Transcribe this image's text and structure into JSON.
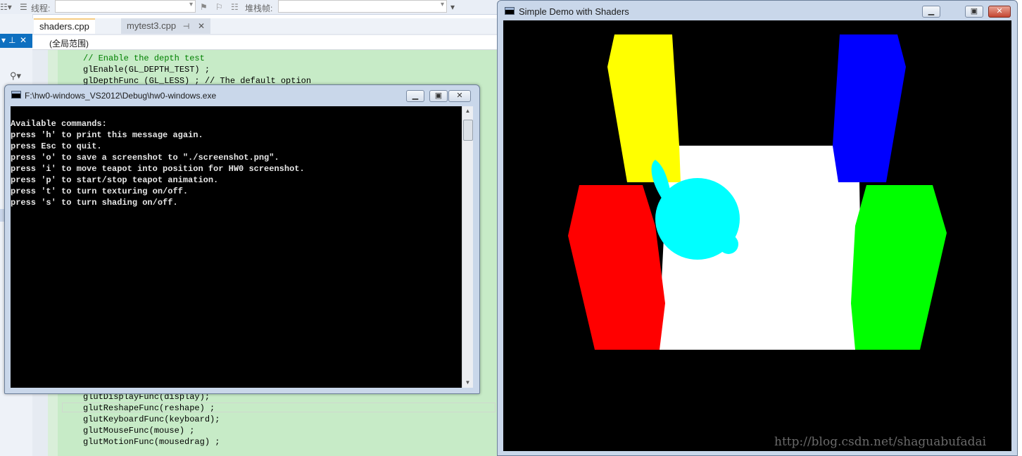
{
  "ide": {
    "toolbar": {
      "thread_label": "线程:",
      "stackframe_label": "堆栈帧:"
    },
    "tabs": [
      {
        "label": "shaders.cpp",
        "active": true
      },
      {
        "label": "mytest3.cpp",
        "active": false
      }
    ],
    "scope": "(全局范围)",
    "code_top": [
      "// Enable the depth test",
      "glEnable(GL_DEPTH_TEST) ;",
      "glDepthFunc (GL_LESS) ; // The default option"
    ],
    "code_bottom": [
      "glutDisplayFunc(display);",
      "glutReshapeFunc(reshape) ;",
      "glutKeyboardFunc(keyboard);",
      "glutMouseFunc(mouse) ;",
      "glutMotionFunc(mousedrag) ;"
    ]
  },
  "console": {
    "title": "F:\\hw0-windows_VS2012\\Debug\\hw0-windows.exe",
    "lines": [
      "Available commands:",
      "press 'h' to print this message again.",
      "press Esc to quit.",
      "press 'o' to save a screenshot to \"./screenshot.png\".",
      "press 'i' to move teapot into position for HW0 screenshot.",
      "press 'p' to start/stop teapot animation.",
      "press 't' to turn texturing on/off.",
      "press 's' to turn shading on/off."
    ]
  },
  "gl_window": {
    "title": "Simple Demo with Shaders",
    "colors": {
      "background": "#000000",
      "floor": "#ffffff",
      "teapot": "#00ffff",
      "pillar_yellow": "#ffff00",
      "pillar_blue": "#0000ff",
      "pillar_red": "#ff0000",
      "pillar_green": "#00ff00"
    }
  },
  "watermark": "http://blog.csdn.net/shaguabufadai"
}
